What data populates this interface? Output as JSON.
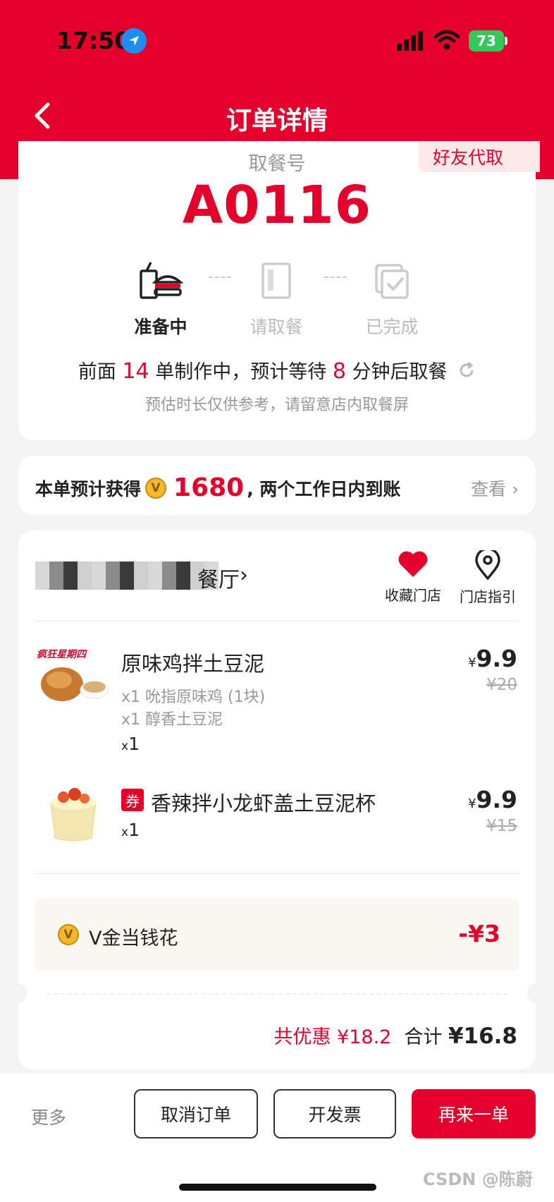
{
  "status_bar": {
    "time": "17:50",
    "battery": "73"
  },
  "header": {
    "title": "订单详情"
  },
  "pickup": {
    "friend_tag": "好友代取",
    "label": "取餐号",
    "number": "A0116",
    "steps": [
      {
        "label": "准备中",
        "active": true
      },
      {
        "label": "请取餐",
        "active": false
      },
      {
        "label": "已完成",
        "active": false
      }
    ],
    "queue_prefix": "前面",
    "queue_count": "14",
    "queue_middle": "单制作中，预计等待",
    "wait_minutes": "8",
    "queue_suffix": "分钟后取餐",
    "note": "预估时长仅供参考，请留意店内取餐屏"
  },
  "points": {
    "prefix": "本单预计获得",
    "coin_icon": "V",
    "amount": "1680",
    "suffix": ", 两个工作日内到账",
    "view_label": "查看"
  },
  "store": {
    "name_tail": "餐厅",
    "favorite_label": "收藏门店",
    "guide_label": "门店指引"
  },
  "items": [
    {
      "name": "原味鸡拌土豆泥",
      "sub1": "x1 吮指原味鸡 (1块)",
      "sub2": "x1 醇香土豆泥",
      "qty_x": "x",
      "qty": "1",
      "currency": "¥",
      "price": "9.9",
      "old_price": "¥20",
      "image_caption": "疯狂星期四"
    },
    {
      "coupon": "券",
      "name": "香辣拌小龙虾盖土豆泥杯",
      "qty_x": "x",
      "qty": "1",
      "currency": "¥",
      "price": "9.9",
      "old_price": "¥15"
    }
  ],
  "vgold": {
    "icon": "V",
    "label": "V金当钱花",
    "amount": "-¥3"
  },
  "totals": {
    "discount_label": "共优惠 ¥18.2",
    "total_label": "合计",
    "total_value": "¥16.8"
  },
  "actions": {
    "more": "更多",
    "cancel": "取消订单",
    "invoice": "开发票",
    "reorder": "再来一单"
  },
  "watermark": "CSDN @陈蔚",
  "colors": {
    "brand_red": "#e4002b",
    "background": "#f3f3f3"
  }
}
